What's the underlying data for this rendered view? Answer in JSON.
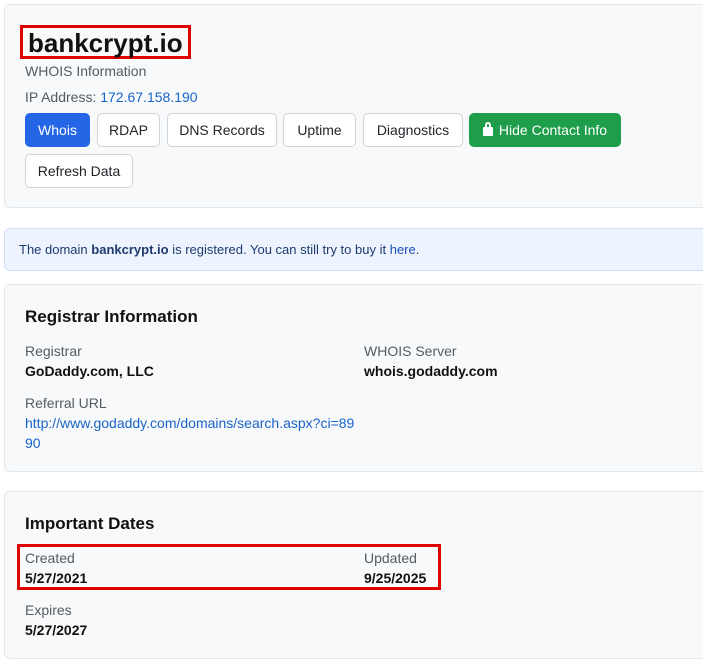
{
  "domain": "bankcrypt.io",
  "subtitle": "WHOIS Information",
  "ip": {
    "label": "IP Address:",
    "value": "172.67.158.190"
  },
  "tabs": [
    {
      "label": "Whois"
    },
    {
      "label": "RDAP"
    },
    {
      "label": "DNS Records"
    },
    {
      "label": "Uptime"
    },
    {
      "label": "Diagnostics"
    },
    {
      "label": "Hide Contact Info"
    },
    {
      "label": "Refresh Data"
    }
  ],
  "alert": {
    "prefix": "The domain",
    "domain": "bankcrypt.io",
    "middle": "is registered. You can still try to buy it",
    "link": "here",
    "suffix": "."
  },
  "registrar": {
    "title": "Registrar Information",
    "registrar_label": "Registrar",
    "registrar_value": "GoDaddy.com, LLC",
    "whois_label": "WHOIS Server",
    "whois_value": "whois.godaddy.com",
    "referral_label": "Referral URL",
    "referral_value": "http://www.godaddy.com/domains/search.aspx?ci=8990"
  },
  "dates": {
    "title": "Important Dates",
    "created_label": "Created",
    "created_value": "5/27/2021",
    "updated_label": "Updated",
    "updated_value": "9/25/2025",
    "expires_label": "Expires",
    "expires_value": "5/27/2027"
  },
  "colors": {
    "primary": "#2466e6",
    "success": "#1e9e4a",
    "link": "#1a64c8",
    "highlight": "#e00000"
  }
}
